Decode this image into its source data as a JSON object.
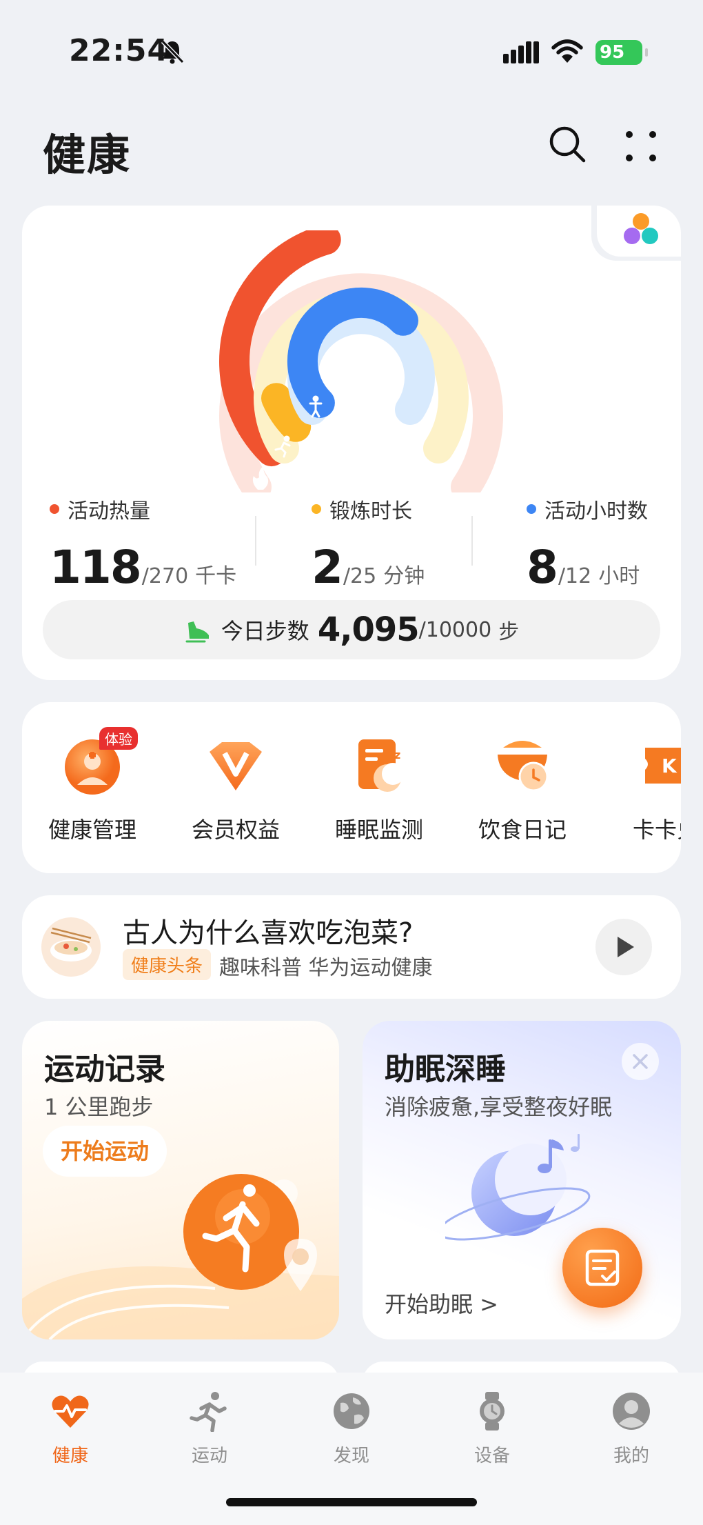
{
  "status_bar": {
    "time": "22:54",
    "battery": "95"
  },
  "header": {
    "title": "健康"
  },
  "activity": {
    "calories": {
      "label": "活动热量",
      "value": "118",
      "goal": "/270",
      "unit": "千卡",
      "color": "#f0532f",
      "progress": 0.44
    },
    "exercise": {
      "label": "锻炼时长",
      "value": "2",
      "goal": "/25",
      "unit": "分钟",
      "color": "#fbb525",
      "progress": 0.08
    },
    "active_hours": {
      "label": "活动小时数",
      "value": "8",
      "goal": "/12",
      "unit": "小时",
      "color": "#3d86f4",
      "progress": 0.67
    },
    "steps": {
      "label": "今日步数",
      "value": "4,095",
      "goal": "/10000",
      "unit": "步"
    }
  },
  "services": [
    {
      "label": "健康管理",
      "badge": "体验",
      "icon": "health-manage-icon"
    },
    {
      "label": "会员权益",
      "icon": "vip-icon"
    },
    {
      "label": "睡眠监测",
      "icon": "sleep-monitor-icon"
    },
    {
      "label": "饮食日记",
      "icon": "diet-diary-icon"
    },
    {
      "label": "卡卡兑",
      "icon": "card-exchange-icon"
    }
  ],
  "news": {
    "title": "古人为什么喜欢吃泡菜?",
    "tag": "健康头条",
    "source": "趣味科普 华为运动健康"
  },
  "exercise_card": {
    "title": "运动记录",
    "subtitle": "1 公里跑步",
    "button": "开始运动"
  },
  "sleep_card": {
    "title": "助眠深睡",
    "subtitle": "消除疲惫,享受整夜好眠",
    "action": "开始助眠 >"
  },
  "tabs": [
    {
      "label": "健康",
      "icon": "heart-pulse-icon",
      "active": true
    },
    {
      "label": "运动",
      "icon": "runner-icon",
      "active": false
    },
    {
      "label": "发现",
      "icon": "globe-icon",
      "active": false
    },
    {
      "label": "设备",
      "icon": "watch-icon",
      "active": false
    },
    {
      "label": "我的",
      "icon": "profile-icon",
      "active": false
    }
  ],
  "colors": {
    "accent": "#f0671a",
    "background": "#eff1f5"
  }
}
